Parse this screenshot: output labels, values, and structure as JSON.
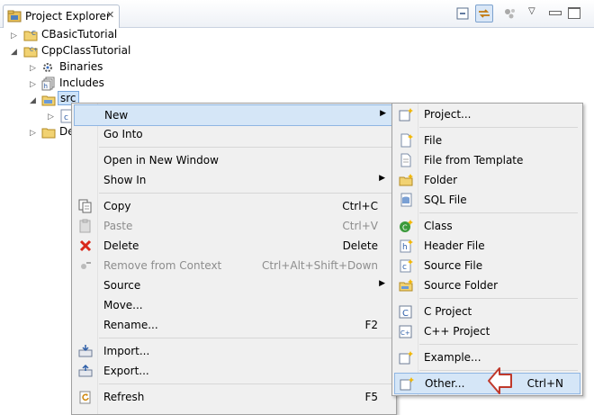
{
  "view": {
    "tab_label": "Project Explorer",
    "close_glyph": "✕",
    "menu_glyph": "▽"
  },
  "tree": [
    {
      "label": "CBasicTutorial",
      "icon": "c-project-folder-icon",
      "twisty": "▷"
    },
    {
      "label": "CppClassTutorial",
      "icon": "cpp-project-folder-icon",
      "twisty": "◢"
    },
    {
      "label": "Binaries",
      "icon": "binaries-icon",
      "twisty": "▷"
    },
    {
      "label": "Includes",
      "icon": "includes-icon",
      "twisty": "▷"
    },
    {
      "label": "src",
      "icon": "source-folder-icon",
      "twisty": "◢"
    },
    {
      "label": "c",
      "icon": "c-file-icon",
      "twisty": "▷"
    },
    {
      "label": "De",
      "icon": "folder-icon",
      "twisty": "▷"
    }
  ],
  "context_menu": {
    "items": [
      {
        "label": "New",
        "shortcut": "",
        "submenu": true,
        "highlighted": true
      },
      {
        "label": "Go Into",
        "shortcut": ""
      },
      {
        "label": "Open in New Window",
        "shortcut": ""
      },
      {
        "label": "Show In",
        "shortcut": "",
        "submenu": true
      },
      {
        "label": "Copy",
        "shortcut": "Ctrl+C",
        "icon": "copy-icon"
      },
      {
        "label": "Paste",
        "shortcut": "Ctrl+V",
        "icon": "paste-icon",
        "disabled": true
      },
      {
        "label": "Delete",
        "shortcut": "Delete",
        "icon": "delete-icon"
      },
      {
        "label": "Remove from Context",
        "shortcut": "Ctrl+Alt+Shift+Down",
        "icon": "remove-context-icon",
        "disabled": true
      },
      {
        "label": "Source",
        "shortcut": "",
        "submenu": true
      },
      {
        "label": "Move...",
        "shortcut": ""
      },
      {
        "label": "Rename...",
        "shortcut": "F2"
      },
      {
        "label": "Import...",
        "shortcut": "",
        "icon": "import-icon"
      },
      {
        "label": "Export...",
        "shortcut": "",
        "icon": "export-icon"
      },
      {
        "label": "Refresh",
        "shortcut": "F5",
        "icon": "refresh-icon"
      }
    ],
    "submenu_arrow": "▶"
  },
  "new_submenu": {
    "items": [
      {
        "label": "Project...",
        "icon": "new-project-icon"
      },
      {
        "label": "File",
        "icon": "new-file-icon"
      },
      {
        "label": "File from Template",
        "icon": "file-template-icon"
      },
      {
        "label": "Folder",
        "icon": "new-folder-icon"
      },
      {
        "label": "SQL File",
        "icon": "sql-file-icon"
      },
      {
        "label": "Class",
        "icon": "new-class-icon"
      },
      {
        "label": "Header File",
        "icon": "header-file-icon"
      },
      {
        "label": "Source File",
        "icon": "source-file-icon"
      },
      {
        "label": "Source Folder",
        "icon": "source-folder-new-icon"
      },
      {
        "label": "C Project",
        "icon": "c-project-icon"
      },
      {
        "label": "C++ Project",
        "icon": "cpp-project-icon"
      },
      {
        "label": "Example...",
        "icon": "example-icon"
      },
      {
        "label": "Other...",
        "shortcut": "Ctrl+N",
        "icon": "other-wizard-icon",
        "highlighted": true
      }
    ]
  },
  "colors": {
    "highlight": "#d5e6f7",
    "highlight_border": "#8fb6e3",
    "pointer_stroke": "#c0392b",
    "delete_red": "#d9281a"
  }
}
